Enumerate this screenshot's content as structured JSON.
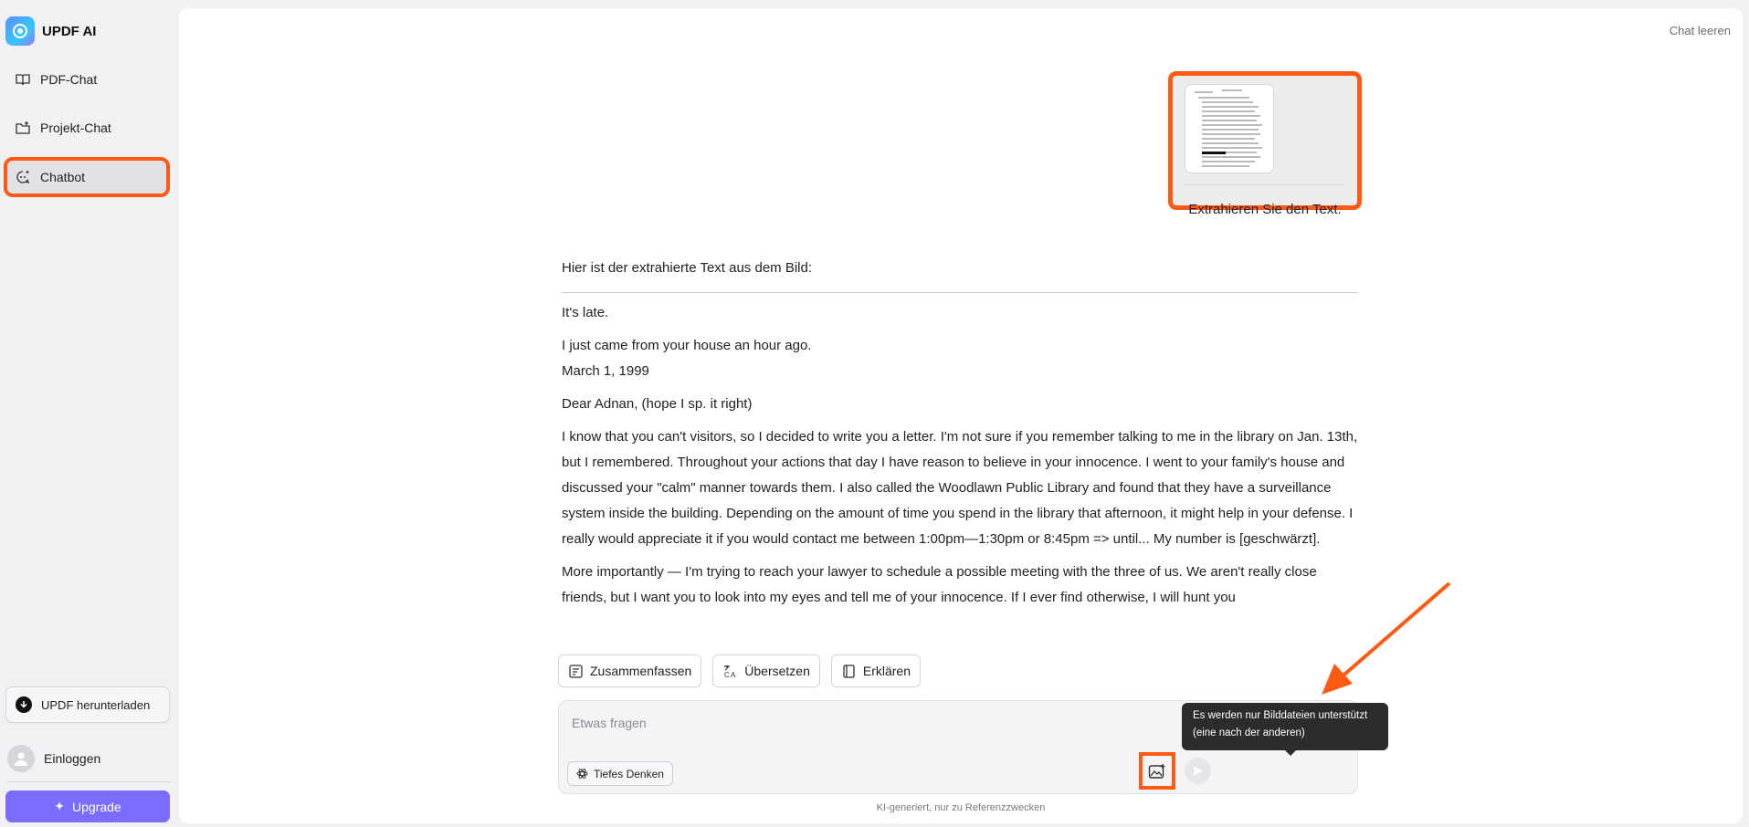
{
  "brand": {
    "title": "UPDF AI"
  },
  "sidebar": {
    "items": [
      {
        "label": "PDF-Chat",
        "icon": "book-open-icon"
      },
      {
        "label": "Projekt-Chat",
        "icon": "folder-plus-icon"
      },
      {
        "label": "Chatbot",
        "icon": "chatbot-icon",
        "active": true
      }
    ],
    "download_label": "UPDF herunterladen",
    "login_label": "Einloggen",
    "upgrade_label": "Upgrade"
  },
  "header": {
    "clear_chat": "Chat leeren"
  },
  "conversation": {
    "user_message": {
      "text": "Extrahieren Sie den Text."
    },
    "assistant": {
      "intro": "Hier ist der extrahierte Text aus dem Bild:",
      "paragraphs": [
        "It's late.",
        "I just came from your house an hour ago.",
        "March 1, 1999",
        "Dear Adnan, (hope I sp. it right)",
        "I know that you can't visitors, so I decided to write you a letter. I'm not sure if you remember talking to me in the library on Jan. 13th, but I remembered. Throughout your actions that day I have reason to believe in your innocence. I went to your family's house and discussed your \"calm\" manner towards them. I also called the Woodlawn Public Library and found that they have a surveillance system inside the building. Depending on the amount of time you spend in the library that afternoon, it might help in your defense. I really would appreciate it if you would contact me between 1:00pm—1:30pm or 8:45pm => until... My number is [geschwärzt].",
        "More importantly — I'm trying to reach your lawyer to schedule a possible meeting with the three of us. We aren't really close friends, but I want you to look into my eyes and tell me of your innocence. If I ever find otherwise, I will hunt you"
      ]
    }
  },
  "quick_actions": {
    "summarize": "Zusammenfassen",
    "translate": "Übersetzen",
    "explain": "Erklären"
  },
  "input": {
    "placeholder": "Etwas fragen",
    "value": "",
    "deep_think_label": "Tiefes Denken"
  },
  "tooltip": {
    "line1": "Es werden nur Bilddateien unterstützt",
    "line2": "(eine nach der anderen)"
  },
  "footer": {
    "disclaimer": "KI-generiert, nur zu Referenzzwecken"
  },
  "colors": {
    "highlight": "#ff5a14",
    "upgrade": "#7a6cff"
  }
}
